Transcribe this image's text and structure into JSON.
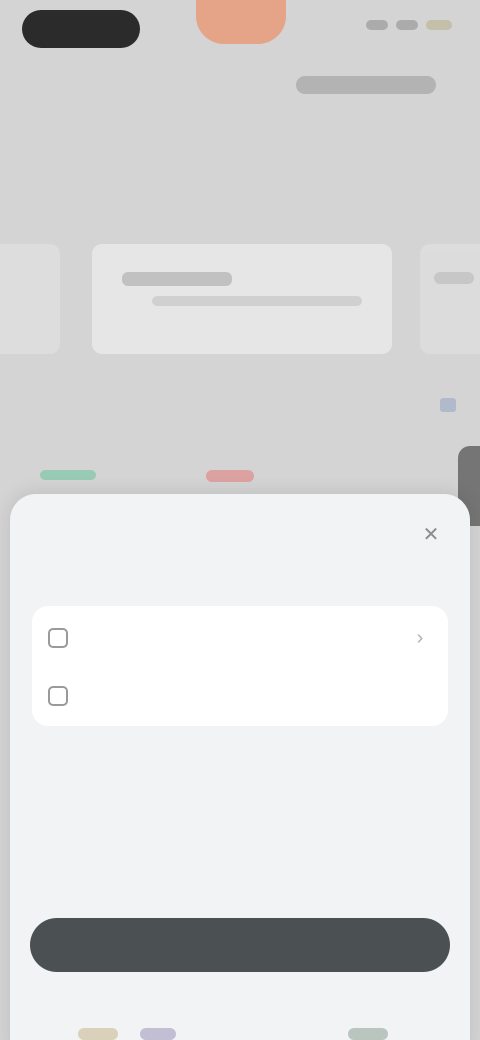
{
  "page": {
    "title": "",
    "subtitle": ""
  },
  "section": {
    "label": ""
  },
  "sheet": {
    "title": "",
    "caption": "",
    "options": [
      {
        "label": "",
        "icon": "folder-icon"
      },
      {
        "label": "",
        "icon": "folder-icon"
      }
    ],
    "confirm_label": "",
    "close_icon": "close-icon"
  },
  "colors": {
    "sheet_background": "#f2f3f5",
    "confirm_button": "#4b5153",
    "accent_orange": "#e89a7a",
    "accent_green": "#7fc7a8",
    "accent_red": "#e08b8b"
  }
}
